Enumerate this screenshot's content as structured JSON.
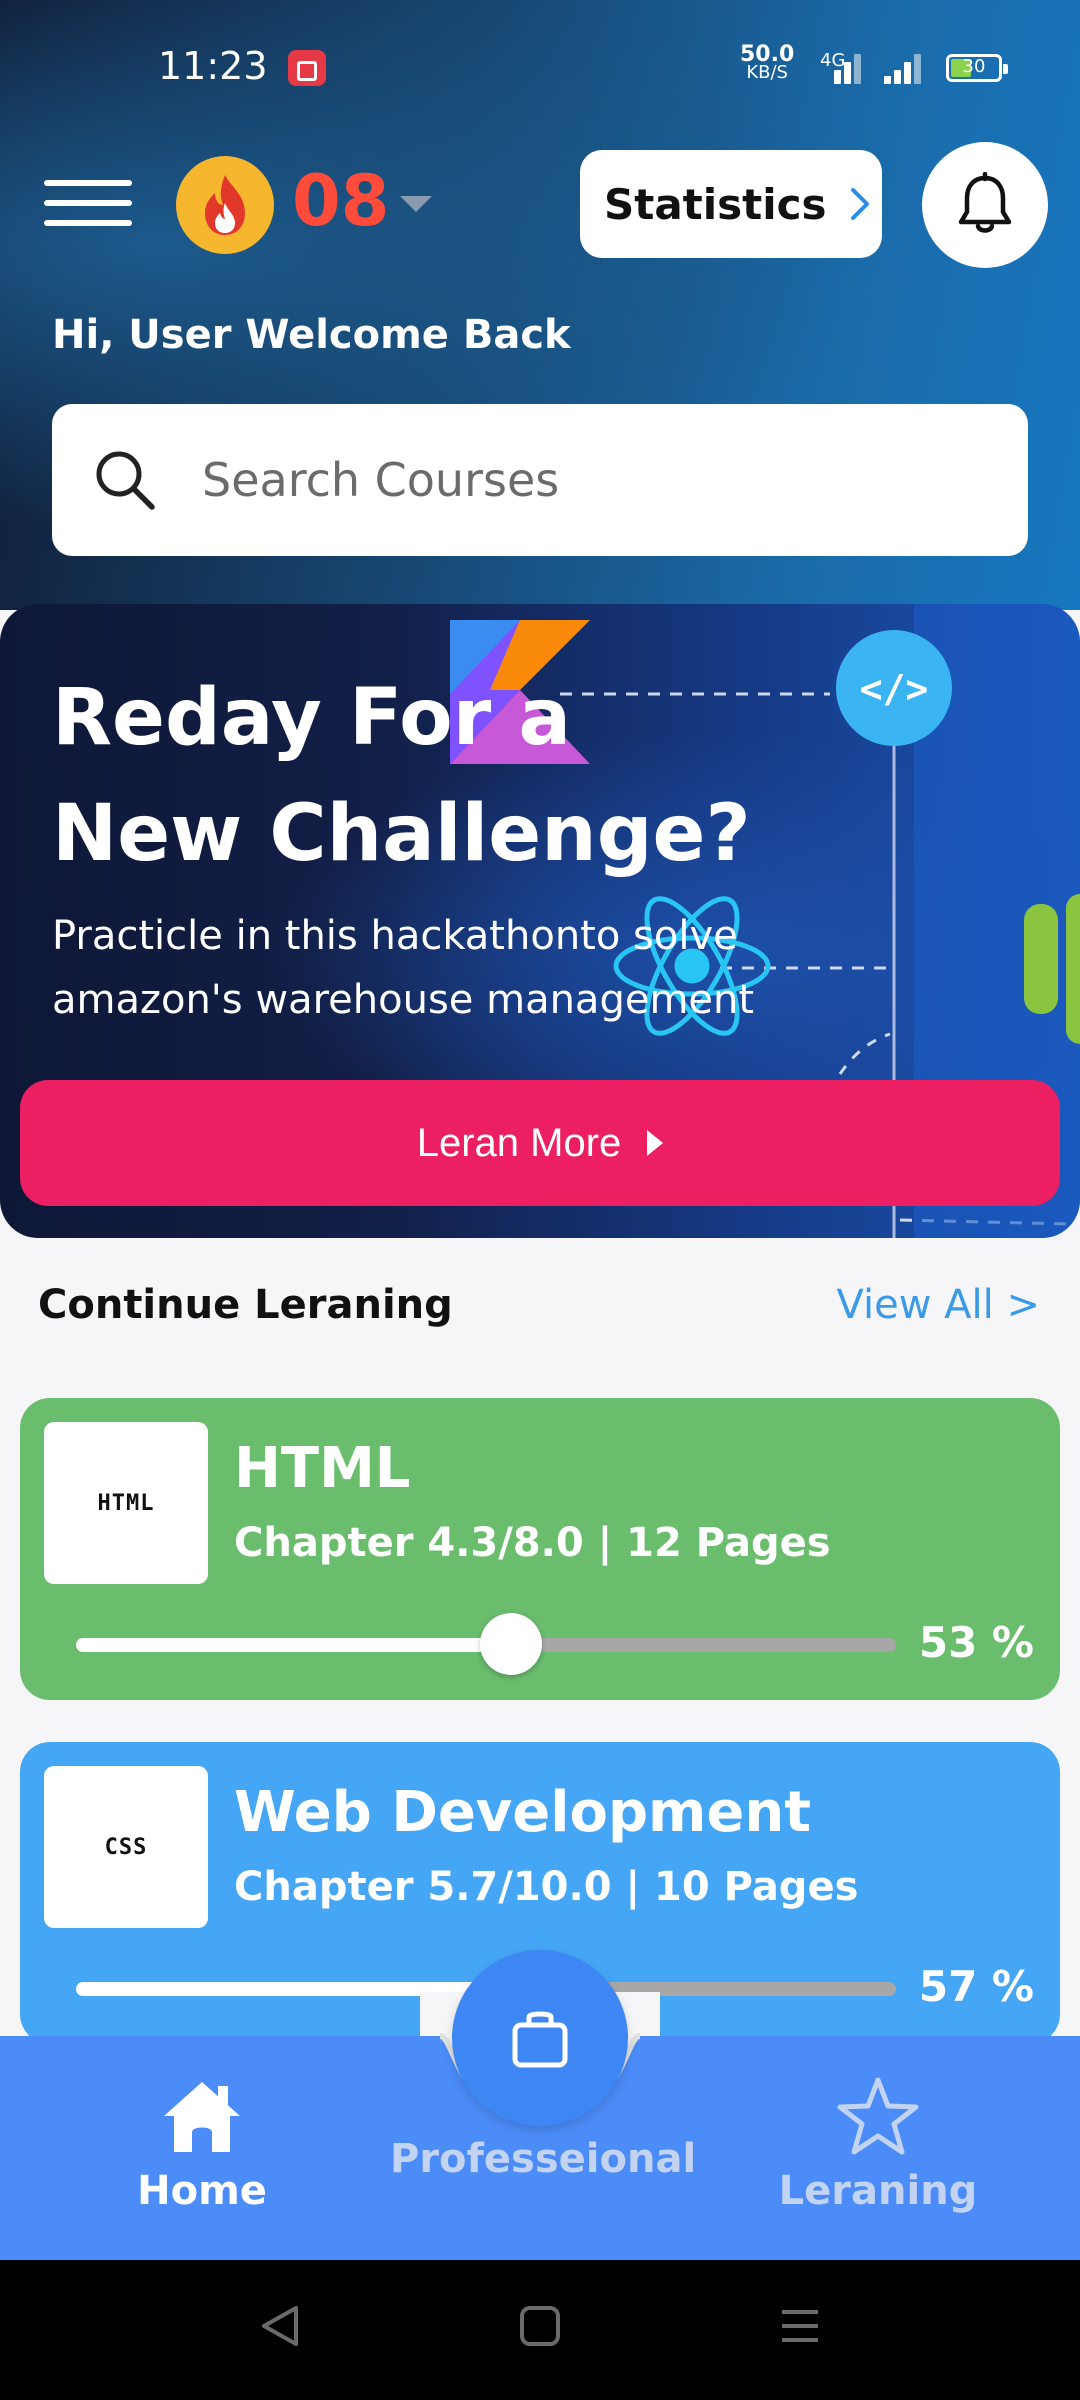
{
  "status_bar": {
    "time": "11:23",
    "net_speed_value": "50.0",
    "net_speed_unit": "KB/S",
    "network_type": "4G",
    "battery": "30"
  },
  "header": {
    "streak_count": "08",
    "statistics_label": "Statistics"
  },
  "greeting": "Hi, User Welcome Back",
  "search": {
    "placeholder": "Search Courses",
    "value": ""
  },
  "banner": {
    "title": "Reday For a New Challenge?",
    "subtitle": "Practicle in this hackathonto solve amazon's warehouse management",
    "button_label": "Leran More"
  },
  "continue_learning": {
    "title": "Continue Leraning",
    "view_all": "View All >",
    "courses": [
      {
        "thumb": "HTML",
        "name": "HTML",
        "meta": "Chapter 4.3/8.0 | 12 Pages",
        "progress_label": "53 %",
        "progress": 0.53
      },
      {
        "thumb": "CSS",
        "name": "Web Development",
        "meta": "Chapter 5.7/10.0 | 10 Pages",
        "progress_label": "57 %",
        "progress": 0.57
      }
    ]
  },
  "bottom_nav": {
    "items": [
      {
        "label": "Home",
        "icon": "home-icon",
        "active": true
      },
      {
        "label": "Professeional",
        "icon": "briefcase-icon",
        "active": false
      },
      {
        "label": "Leraning",
        "icon": "star-icon",
        "active": false
      }
    ]
  },
  "colors": {
    "accent": "#ec1f63",
    "streak": "#ff4b3a",
    "html_card": "#69bd6d",
    "css_card": "#44a6f4",
    "nav": "#4b8cf8"
  }
}
